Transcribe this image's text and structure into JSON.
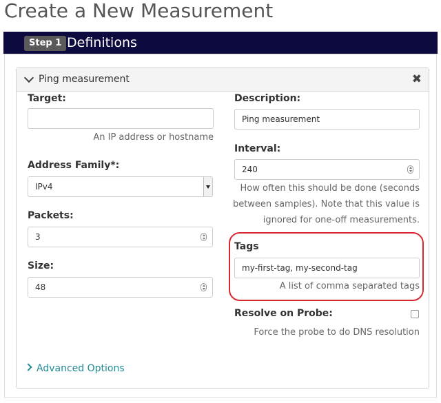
{
  "page": {
    "title": "Create a New Measurement"
  },
  "step": {
    "badge": "Step 1",
    "title": "Definitions"
  },
  "card": {
    "title": "Ping measurement",
    "close_symbol": "✖"
  },
  "fields": {
    "target": {
      "label": "Target:",
      "value": "",
      "help": "An IP address or hostname"
    },
    "address_family": {
      "label": "Address Family*:",
      "value": "IPv4"
    },
    "packets": {
      "label": "Packets:",
      "value": "3"
    },
    "size": {
      "label": "Size:",
      "value": "48"
    },
    "description": {
      "label": "Description:",
      "value": "Ping measurement"
    },
    "interval": {
      "label": "Interval:",
      "value": "240",
      "help_lines": [
        "How often this should be done (seconds",
        "between samples). Note that this value is",
        "ignored for one-off measurements."
      ]
    },
    "tags": {
      "label": "Tags",
      "value": "my-first-tag, my-second-tag",
      "help": "A list of comma separated tags"
    },
    "resolve_on_probe": {
      "label": "Resolve on Probe:",
      "checked": false,
      "help": "Force the probe to do DNS resolution"
    }
  },
  "advanced": {
    "label": "Advanced Options"
  },
  "colors": {
    "header_bg": "#0d0a3f",
    "badge_bg": "#5a5a5a",
    "highlight": "#d8282f",
    "link": "#1f8a94"
  },
  "icons": {
    "card_toggle": "chevron-down-icon",
    "close": "close-icon",
    "advanced_toggle": "chevron-right-icon"
  }
}
